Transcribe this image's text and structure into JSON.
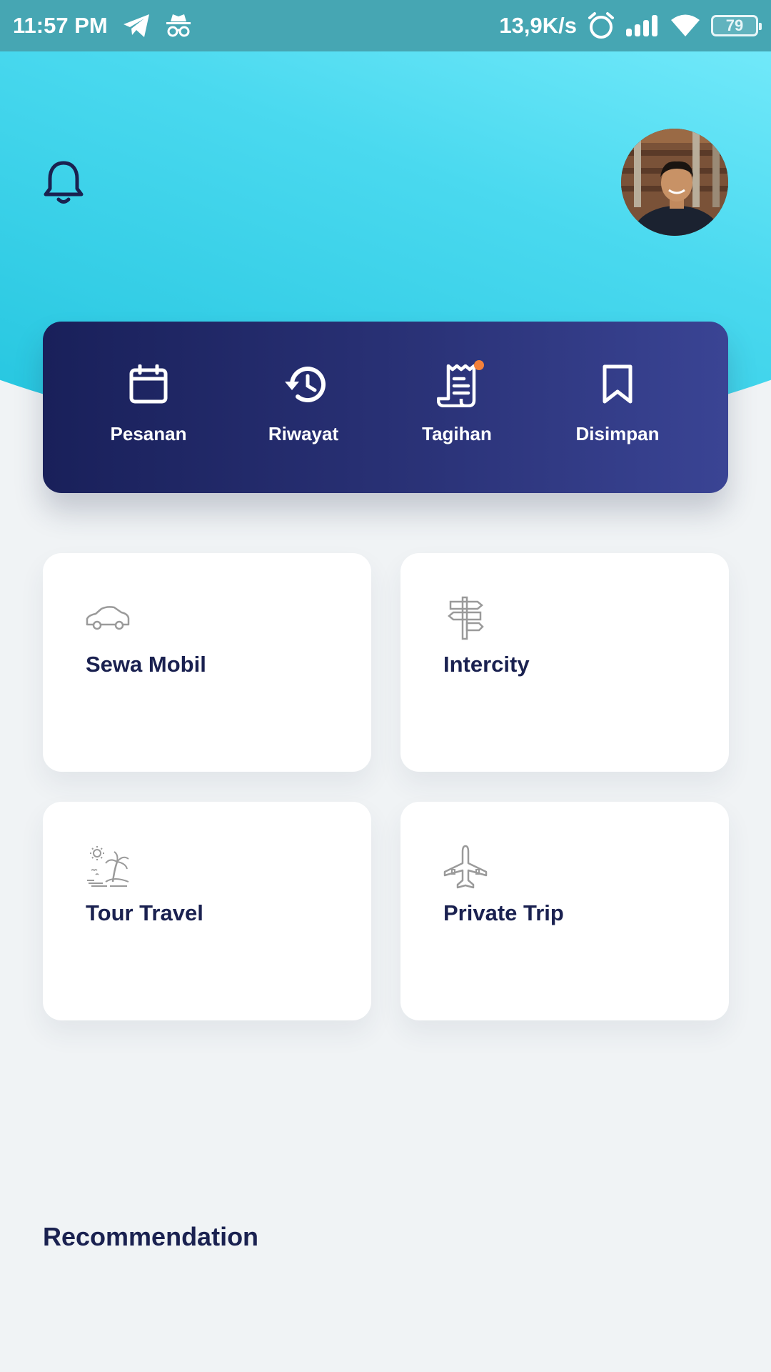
{
  "status_bar": {
    "time": "11:57 PM",
    "network_speed": "13,9K/s",
    "battery_level": "79",
    "icons": [
      "telegram-icon",
      "incognito-icon",
      "alarm-icon",
      "signal-icon",
      "wifi-icon",
      "battery-icon"
    ]
  },
  "header": {
    "notification_icon": "bell-icon",
    "avatar": "profile-avatar"
  },
  "quick_menu": {
    "items": [
      {
        "label": "Pesanan",
        "icon": "calendar-icon"
      },
      {
        "label": "Riwayat",
        "icon": "history-icon"
      },
      {
        "label": "Tagihan",
        "icon": "receipt-icon",
        "has_badge": true
      },
      {
        "label": "Disimpan",
        "icon": "bookmark-icon"
      }
    ],
    "badge_color": "#f4813a"
  },
  "services": [
    {
      "title": "Sewa Mobil",
      "icon": "car-icon"
    },
    {
      "title": "Intercity",
      "icon": "signpost-icon"
    },
    {
      "title": "Tour Travel",
      "icon": "beach-icon"
    },
    {
      "title": "Private Trip",
      "icon": "airplane-icon"
    }
  ],
  "sections": {
    "recommendation_title": "Recommendation"
  },
  "colors": {
    "accent_dark": "#1a2150",
    "gradient_light": "#79ecfc",
    "gradient_dark": "#22c4de",
    "background": "#f0f3f5"
  }
}
